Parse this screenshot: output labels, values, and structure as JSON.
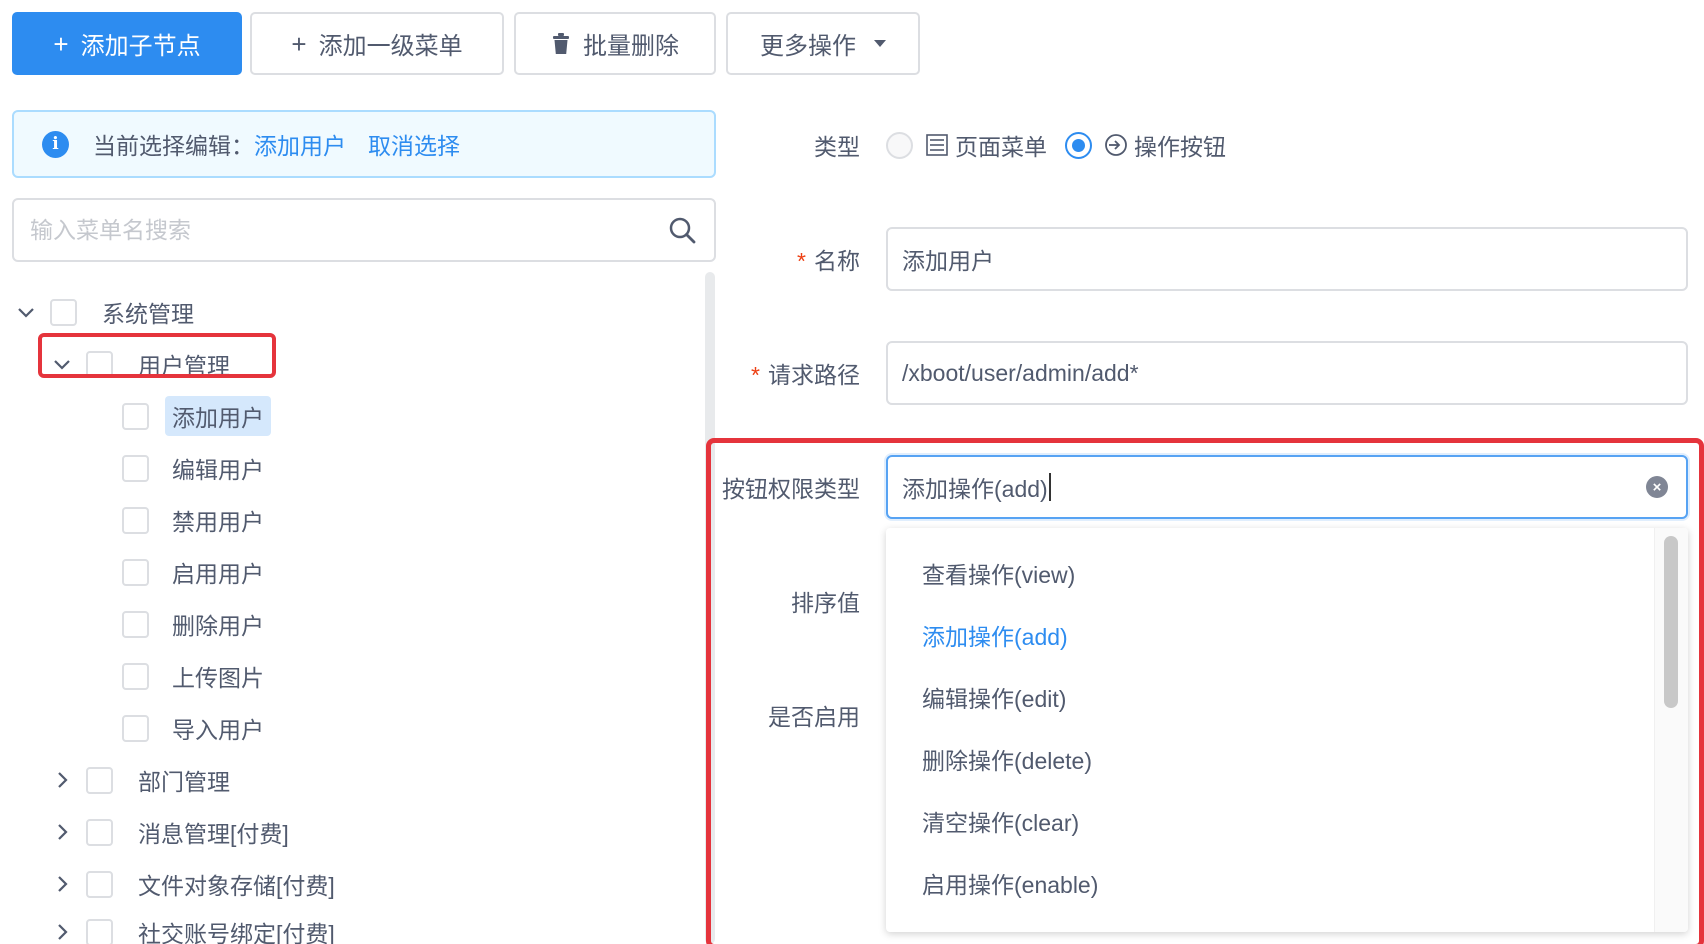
{
  "toolbar": {
    "add_child_label": "添加子节点",
    "add_top_menu_label": "添加一级菜单",
    "batch_delete_label": "批量删除",
    "more_actions_label": "更多操作",
    "plus_glyph": "+"
  },
  "alert": {
    "prefix": "当前选择编辑：",
    "selected": "添加用户",
    "cancel": "取消选择"
  },
  "search": {
    "placeholder": "输入菜单名搜索"
  },
  "tree": {
    "root": "系统管理",
    "user_mgmt": "用户管理",
    "children": [
      "添加用户",
      "编辑用户",
      "禁用用户",
      "启用用户",
      "删除用户",
      "上传图片",
      "导入用户"
    ],
    "siblings": [
      "部门管理",
      "消息管理[付费]",
      "文件对象存储[付费]",
      "社交账号绑定[付费]"
    ]
  },
  "form": {
    "type_label": "类型",
    "type_options": [
      "页面菜单",
      "操作按钮"
    ],
    "type_selected": "操作按钮",
    "name_label": "名称",
    "name_value": "添加用户",
    "path_label": "请求路径",
    "path_value": "/xboot/user/admin/add*",
    "perm_label": "按钮权限类型",
    "perm_value": "添加操作(add)",
    "sort_label": "排序值",
    "enabled_label": "是否启用",
    "required_mark": "*"
  },
  "dropdown": {
    "options": [
      "查看操作(view)",
      "添加操作(add)",
      "编辑操作(edit)",
      "删除操作(delete)",
      "清空操作(clear)",
      "启用操作(enable)"
    ],
    "active": "添加操作(add)"
  },
  "colors": {
    "primary": "#2d8cf0",
    "highlight_box": "#e5343c",
    "required": "#ed4014"
  }
}
